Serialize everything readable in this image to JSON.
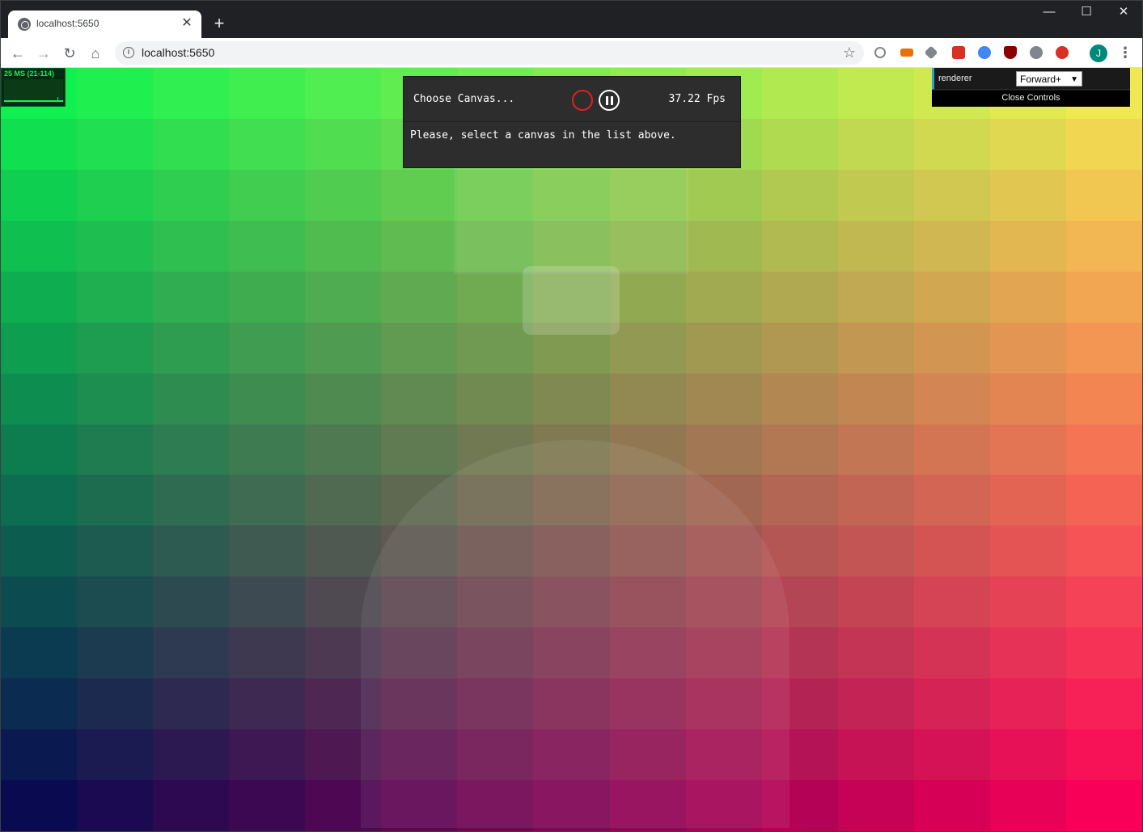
{
  "browser": {
    "tab_title": "localhost:5650",
    "url": "localhost:5650",
    "profile_initial": "J"
  },
  "stats": {
    "label": "25 MS (21-114)"
  },
  "inspector": {
    "title": "Choose Canvas...",
    "fps": "37.22 Fps",
    "message": "Please, select a canvas in the list above."
  },
  "controls": {
    "renderer_label": "renderer",
    "renderer_value": "Forward+",
    "close_label": "Close Controls"
  },
  "colors": {
    "canvas_top_left": "#10f050",
    "canvas_top_right": "#f0e850",
    "canvas_bottom_left": "#0a0a50",
    "canvas_bottom_right": "#f80058",
    "record_accent": "#e02020",
    "controls_accent": "#2fa1d6"
  }
}
